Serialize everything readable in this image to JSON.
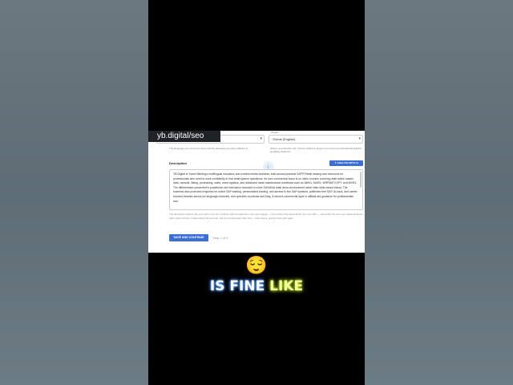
{
  "watermark": "yb.digital/seo",
  "form": {
    "language_label": "Output",
    "language_value": "Global (English)",
    "help_left": "The language your comment must, and the language are write software to",
    "help_right": "Where you primarily sell. Choose Global to target if you serve an international English-speaking audience.",
    "description_label": "Description",
    "analyze_button": "✦ ANALYZE WITH AI",
    "description_text": "YB.Digital is Yoann Bierling's multilingual education and content media business, built around practical SAP® Retail training and resources for professionals who need to work confidently in real retail system operations. Its core commercial focus is on video courses covering retail article master data, variants, listing, purchasing, sales, store logistics, and advanced mass maintenance workflows such as MM41, MASS, WRFMATCOPY, and MSH3. The differentiator presented is practitioner-led instruction recorded in a live S/4HANA retail demo environment rather than slide-based theory. The business also promotes enquiries for online SAP training, personalized training, and access to live SAP systems, publishes free SAP, AI-hack, and career-focused tutorials across six language channels, and operates a podcast and blog. A second commercial layer is affiliate-led guidance for professionals and",
    "hint_text": "The description carries into your site's core text, Analyze with AI reads from your site's pages — the product, the ideal clients, the core offer — and suffer the best your target audience that's what it thinks. It takes about 20 seconds. Set the wording later than that — that means, and it's done with gaps.",
    "save_button": "SAVE AND CONTINUE",
    "step_text": "Step 1 of 5"
  },
  "overlay": {
    "emoji": "😌",
    "caption_white": "IS FINE",
    "caption_yellow": "LIKE"
  },
  "colors": {
    "accent": "#3b6fd4",
    "caption_glow_blue": "#3a7de0",
    "caption_yellow": "#f6ffa0"
  }
}
